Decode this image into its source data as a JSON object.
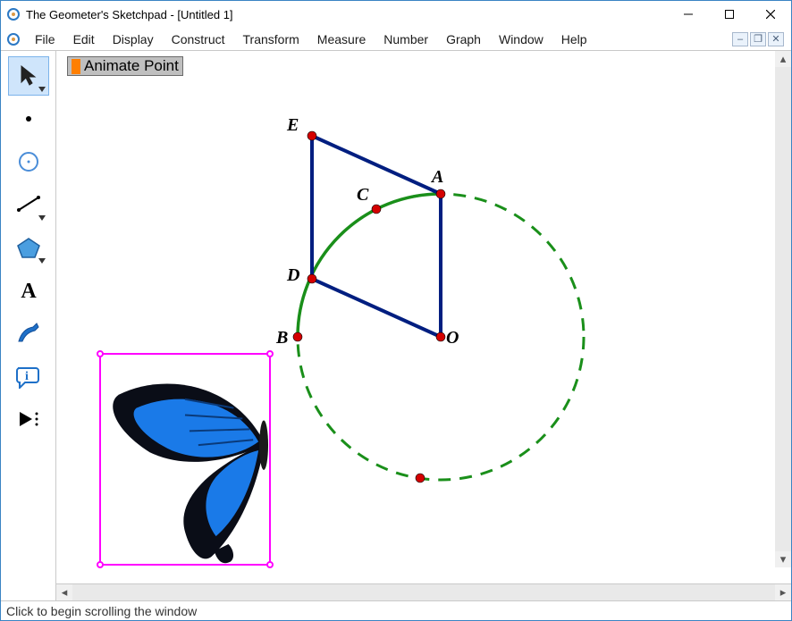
{
  "window": {
    "title": "The Geometer's Sketchpad - [Untitled 1]"
  },
  "menu": {
    "file": "File",
    "edit": "Edit",
    "display": "Display",
    "construct": "Construct",
    "transform": "Transform",
    "measure": "Measure",
    "number": "Number",
    "graph": "Graph",
    "window": "Window",
    "help": "Help"
  },
  "tools": {
    "selection": "selection-arrow",
    "point": "point",
    "compass": "compass",
    "straightedge": "straightedge",
    "polygon": "polygon",
    "text": "text",
    "marker": "marker",
    "info": "information",
    "custom": "custom-tool"
  },
  "actionButton": {
    "label": "Animate Point"
  },
  "points": {
    "A": "A",
    "B": "B",
    "C": "C",
    "D": "D",
    "E": "E",
    "O": "O"
  },
  "status": {
    "text": "Click to begin scrolling the window"
  },
  "colors": {
    "circle": "#1a8f1a",
    "segment": "#001e80",
    "point": "#d40000",
    "selection": "#ff00ff"
  }
}
